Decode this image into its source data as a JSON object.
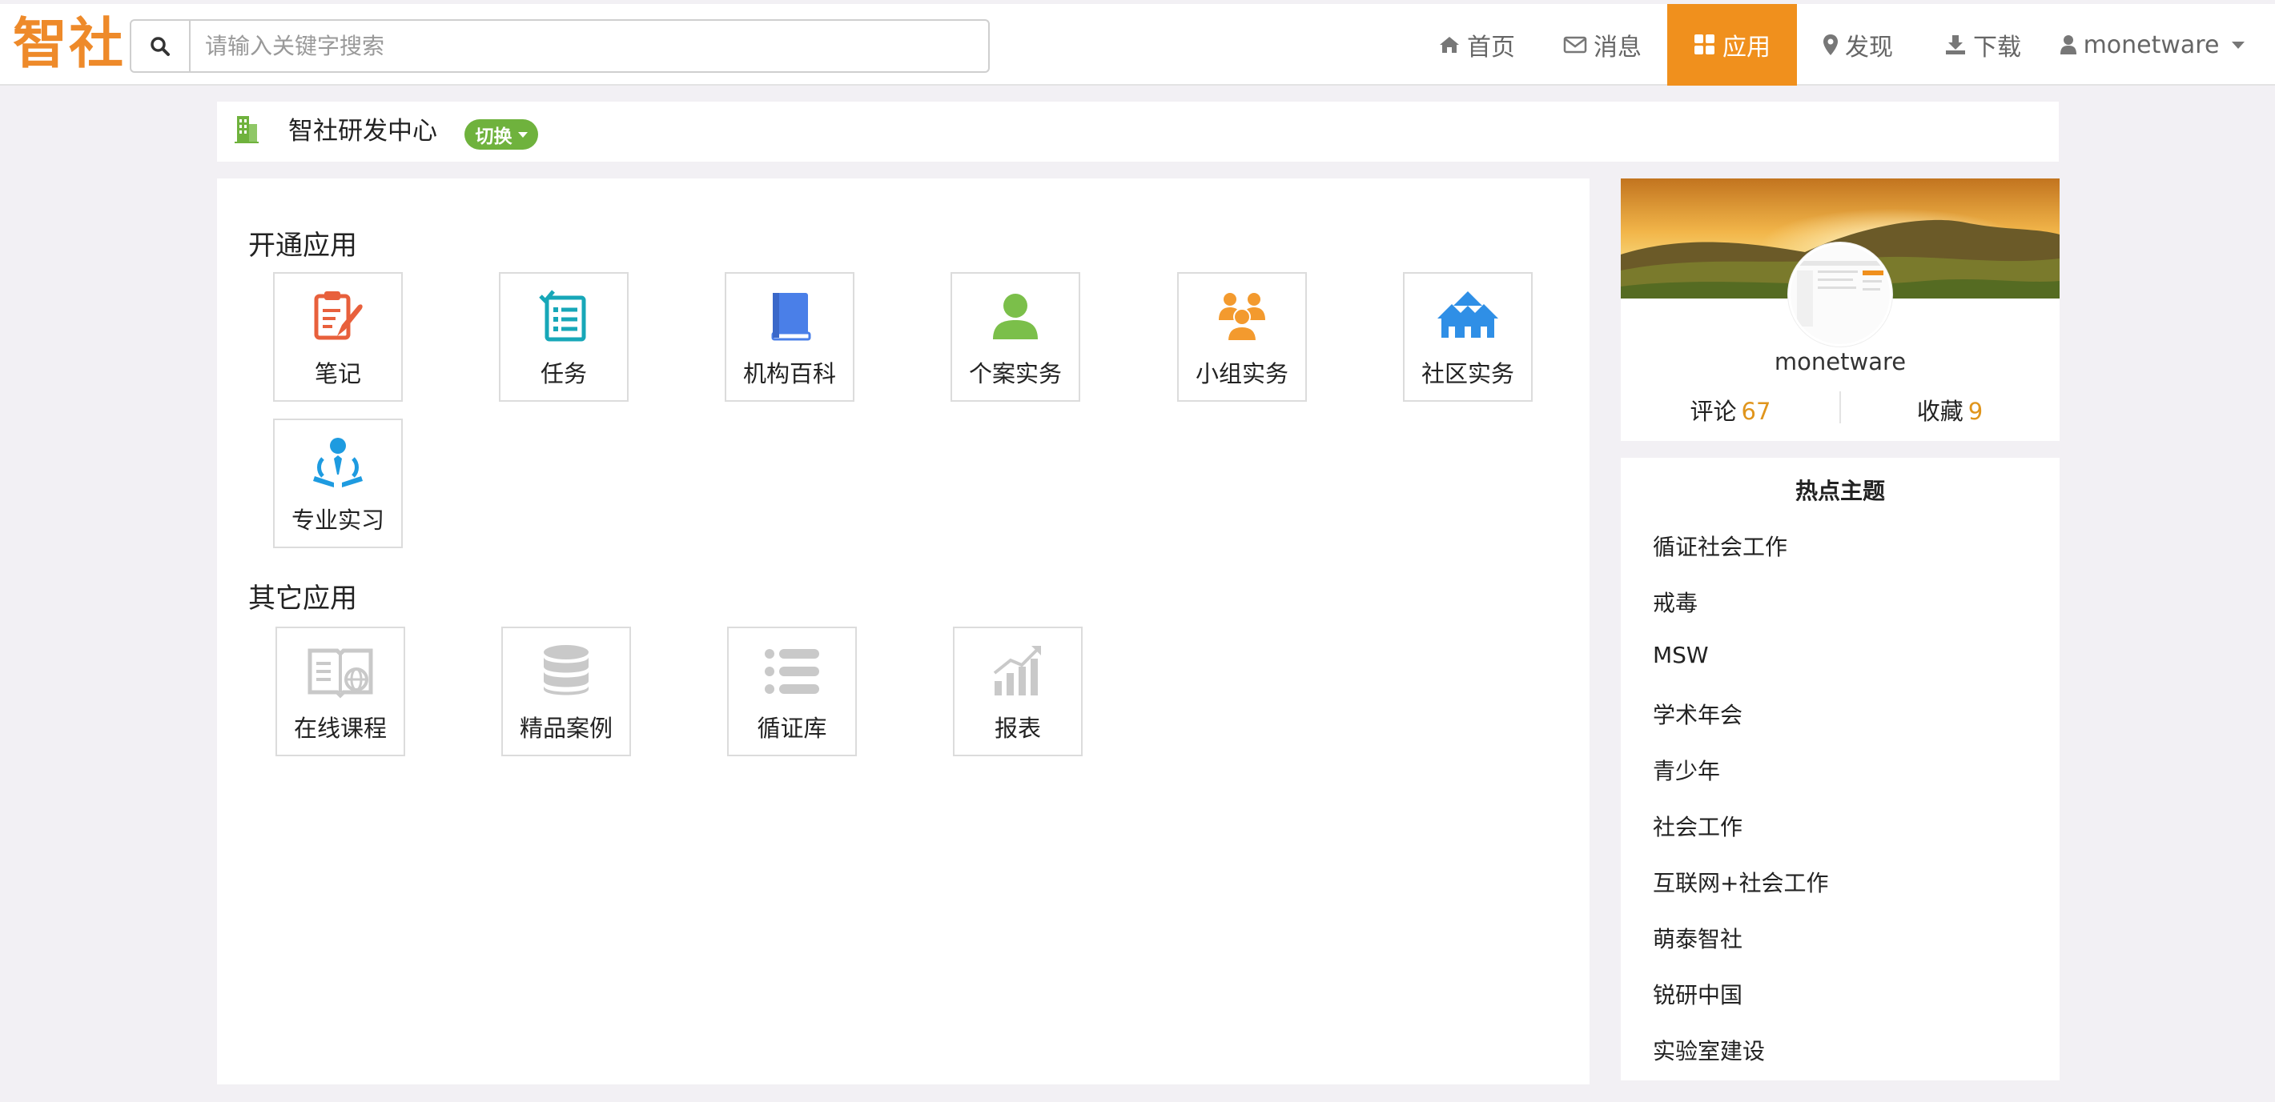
{
  "navbar": {
    "logo": "智社",
    "search": {
      "placeholder": "请输入关键字搜索",
      "value": ""
    },
    "items": [
      {
        "label": "首页",
        "icon": "home-icon"
      },
      {
        "label": "消息",
        "icon": "envelope-icon"
      },
      {
        "label": "应用",
        "icon": "grid-icon",
        "active": true
      },
      {
        "label": "发现",
        "icon": "map-marker-icon"
      },
      {
        "label": "下载",
        "icon": "download-icon"
      },
      {
        "label": "monetware",
        "icon": "user-icon"
      }
    ]
  },
  "org": {
    "name": "智社研发中心",
    "switch_label": "切换"
  },
  "sections": {
    "enabled": {
      "title": "开通应用",
      "apps": [
        {
          "label": "笔记",
          "icon": "notepad-icon",
          "color": "#e8603c"
        },
        {
          "label": "任务",
          "icon": "task-list-icon",
          "color": "#17a7b8"
        },
        {
          "label": "机构百科",
          "icon": "book-icon",
          "color": "#4a7fe8"
        },
        {
          "label": "个案实务",
          "icon": "person-icon",
          "color": "#7bbf4a"
        },
        {
          "label": "小组实务",
          "icon": "group-icon",
          "color": "#f39a2e"
        },
        {
          "label": "社区实务",
          "icon": "houses-icon",
          "color": "#2f8fe6"
        },
        {
          "label": "专业实习",
          "icon": "intern-icon",
          "color": "#1e9be0"
        }
      ]
    },
    "other": {
      "title": "其它应用",
      "apps": [
        {
          "label": "在线课程",
          "icon": "online-course-icon",
          "color": "#c9c9c9"
        },
        {
          "label": "精品案例",
          "icon": "database-icon",
          "color": "#c9c9c9"
        },
        {
          "label": "循证库",
          "icon": "list-icon",
          "color": "#c9c9c9"
        },
        {
          "label": "报表",
          "icon": "chart-icon",
          "color": "#c9c9c9"
        }
      ]
    }
  },
  "profile": {
    "username": "monetware",
    "stats": [
      {
        "label": "评论",
        "value": "67"
      },
      {
        "label": "收藏",
        "value": "9"
      }
    ]
  },
  "hot_topics": {
    "title": "热点主题",
    "items": [
      "循证社会工作",
      "戒毒",
      "MSW",
      "学术年会",
      "青少年",
      "社会工作",
      "互联网+社会工作",
      "萌泰智社",
      "锐研中国",
      "实验室建设"
    ]
  },
  "colors": {
    "accent": "#f0901d",
    "logo": "#ee8a2a",
    "switch": "#6fb23d",
    "stat_number": "#e0951c"
  }
}
